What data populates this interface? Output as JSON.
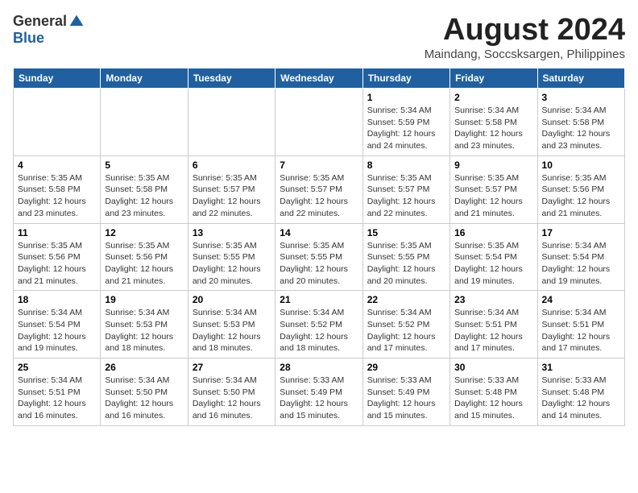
{
  "header": {
    "logo_general": "General",
    "logo_blue": "Blue",
    "month_year": "August 2024",
    "location": "Maindang, Soccsksargen, Philippines"
  },
  "days_of_week": [
    "Sunday",
    "Monday",
    "Tuesday",
    "Wednesday",
    "Thursday",
    "Friday",
    "Saturday"
  ],
  "weeks": [
    [
      {
        "day": "",
        "info": ""
      },
      {
        "day": "",
        "info": ""
      },
      {
        "day": "",
        "info": ""
      },
      {
        "day": "",
        "info": ""
      },
      {
        "day": "1",
        "info": "Sunrise: 5:34 AM\nSunset: 5:59 PM\nDaylight: 12 hours\nand 24 minutes."
      },
      {
        "day": "2",
        "info": "Sunrise: 5:34 AM\nSunset: 5:58 PM\nDaylight: 12 hours\nand 23 minutes."
      },
      {
        "day": "3",
        "info": "Sunrise: 5:34 AM\nSunset: 5:58 PM\nDaylight: 12 hours\nand 23 minutes."
      }
    ],
    [
      {
        "day": "4",
        "info": "Sunrise: 5:35 AM\nSunset: 5:58 PM\nDaylight: 12 hours\nand 23 minutes."
      },
      {
        "day": "5",
        "info": "Sunrise: 5:35 AM\nSunset: 5:58 PM\nDaylight: 12 hours\nand 23 minutes."
      },
      {
        "day": "6",
        "info": "Sunrise: 5:35 AM\nSunset: 5:57 PM\nDaylight: 12 hours\nand 22 minutes."
      },
      {
        "day": "7",
        "info": "Sunrise: 5:35 AM\nSunset: 5:57 PM\nDaylight: 12 hours\nand 22 minutes."
      },
      {
        "day": "8",
        "info": "Sunrise: 5:35 AM\nSunset: 5:57 PM\nDaylight: 12 hours\nand 22 minutes."
      },
      {
        "day": "9",
        "info": "Sunrise: 5:35 AM\nSunset: 5:57 PM\nDaylight: 12 hours\nand 21 minutes."
      },
      {
        "day": "10",
        "info": "Sunrise: 5:35 AM\nSunset: 5:56 PM\nDaylight: 12 hours\nand 21 minutes."
      }
    ],
    [
      {
        "day": "11",
        "info": "Sunrise: 5:35 AM\nSunset: 5:56 PM\nDaylight: 12 hours\nand 21 minutes."
      },
      {
        "day": "12",
        "info": "Sunrise: 5:35 AM\nSunset: 5:56 PM\nDaylight: 12 hours\nand 21 minutes."
      },
      {
        "day": "13",
        "info": "Sunrise: 5:35 AM\nSunset: 5:55 PM\nDaylight: 12 hours\nand 20 minutes."
      },
      {
        "day": "14",
        "info": "Sunrise: 5:35 AM\nSunset: 5:55 PM\nDaylight: 12 hours\nand 20 minutes."
      },
      {
        "day": "15",
        "info": "Sunrise: 5:35 AM\nSunset: 5:55 PM\nDaylight: 12 hours\nand 20 minutes."
      },
      {
        "day": "16",
        "info": "Sunrise: 5:35 AM\nSunset: 5:54 PM\nDaylight: 12 hours\nand 19 minutes."
      },
      {
        "day": "17",
        "info": "Sunrise: 5:34 AM\nSunset: 5:54 PM\nDaylight: 12 hours\nand 19 minutes."
      }
    ],
    [
      {
        "day": "18",
        "info": "Sunrise: 5:34 AM\nSunset: 5:54 PM\nDaylight: 12 hours\nand 19 minutes."
      },
      {
        "day": "19",
        "info": "Sunrise: 5:34 AM\nSunset: 5:53 PM\nDaylight: 12 hours\nand 18 minutes."
      },
      {
        "day": "20",
        "info": "Sunrise: 5:34 AM\nSunset: 5:53 PM\nDaylight: 12 hours\nand 18 minutes."
      },
      {
        "day": "21",
        "info": "Sunrise: 5:34 AM\nSunset: 5:52 PM\nDaylight: 12 hours\nand 18 minutes."
      },
      {
        "day": "22",
        "info": "Sunrise: 5:34 AM\nSunset: 5:52 PM\nDaylight: 12 hours\nand 17 minutes."
      },
      {
        "day": "23",
        "info": "Sunrise: 5:34 AM\nSunset: 5:51 PM\nDaylight: 12 hours\nand 17 minutes."
      },
      {
        "day": "24",
        "info": "Sunrise: 5:34 AM\nSunset: 5:51 PM\nDaylight: 12 hours\nand 17 minutes."
      }
    ],
    [
      {
        "day": "25",
        "info": "Sunrise: 5:34 AM\nSunset: 5:51 PM\nDaylight: 12 hours\nand 16 minutes."
      },
      {
        "day": "26",
        "info": "Sunrise: 5:34 AM\nSunset: 5:50 PM\nDaylight: 12 hours\nand 16 minutes."
      },
      {
        "day": "27",
        "info": "Sunrise: 5:34 AM\nSunset: 5:50 PM\nDaylight: 12 hours\nand 16 minutes."
      },
      {
        "day": "28",
        "info": "Sunrise: 5:33 AM\nSunset: 5:49 PM\nDaylight: 12 hours\nand 15 minutes."
      },
      {
        "day": "29",
        "info": "Sunrise: 5:33 AM\nSunset: 5:49 PM\nDaylight: 12 hours\nand 15 minutes."
      },
      {
        "day": "30",
        "info": "Sunrise: 5:33 AM\nSunset: 5:48 PM\nDaylight: 12 hours\nand 15 minutes."
      },
      {
        "day": "31",
        "info": "Sunrise: 5:33 AM\nSunset: 5:48 PM\nDaylight: 12 hours\nand 14 minutes."
      }
    ]
  ]
}
